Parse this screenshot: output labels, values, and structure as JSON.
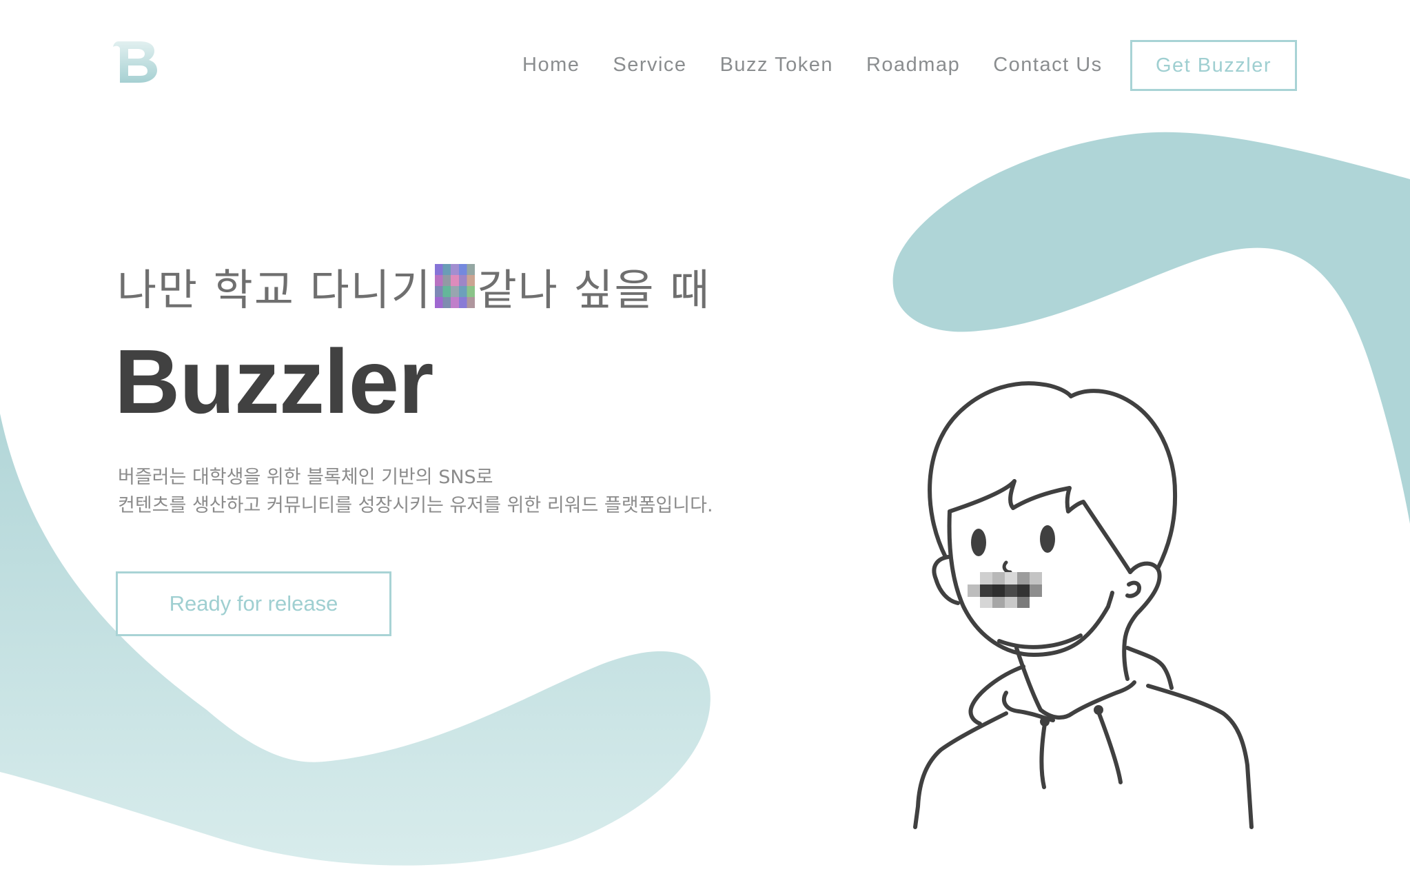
{
  "header": {
    "logo_letter": "B",
    "nav": [
      "Home",
      "Service",
      "Buzz Token",
      "Roadmap",
      "Contact Us"
    ],
    "cta_label": "Get Buzzler"
  },
  "hero": {
    "tagline_before": "나만 학교 다니기",
    "tagline_after": "같나 싶을 때",
    "title": "Buzzler",
    "description": [
      "버즐러는 대학생을 위한 블록체인 기반의 SNS로",
      "컨텐츠를 생산하고 커뮤니티를 성장시키는 유저를 위한 리워드 플랫폼입니다."
    ],
    "button_label": "Ready for release"
  },
  "colors": {
    "accent": "#a8d3d5",
    "shape": "#afd5d7",
    "text_dark": "#414141",
    "text_muted": "#8b8b8b"
  }
}
